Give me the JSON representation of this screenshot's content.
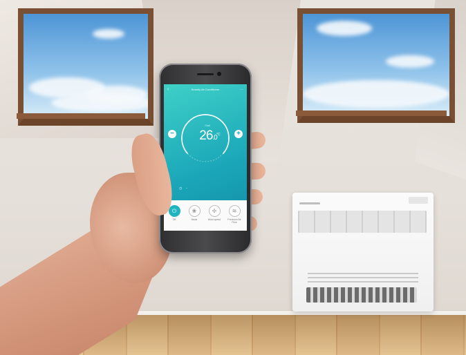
{
  "app": {
    "title": "Smartly Air Conditioner",
    "back_icon": "chevron-left-icon",
    "menu_icon": "more-icon"
  },
  "thermostat": {
    "mode": "Cool",
    "temperature": "26",
    "temperature_decimal": ".0",
    "unit": "°C"
  },
  "controls": [
    {
      "label": "Off",
      "icon": "power-icon",
      "active": true
    },
    {
      "label": "Mode",
      "icon": "mode-icon",
      "active": false
    },
    {
      "label": "Wind speed",
      "icon": "fan-icon",
      "active": false
    },
    {
      "label": "Precision Air Flow",
      "icon": "airflow-icon",
      "active": false
    }
  ],
  "colors": {
    "app_gradient_top": "#3fd0c7",
    "app_gradient_bottom": "#1597ae",
    "accent": "#20b3c0",
    "window_frame": "#7a5034"
  }
}
